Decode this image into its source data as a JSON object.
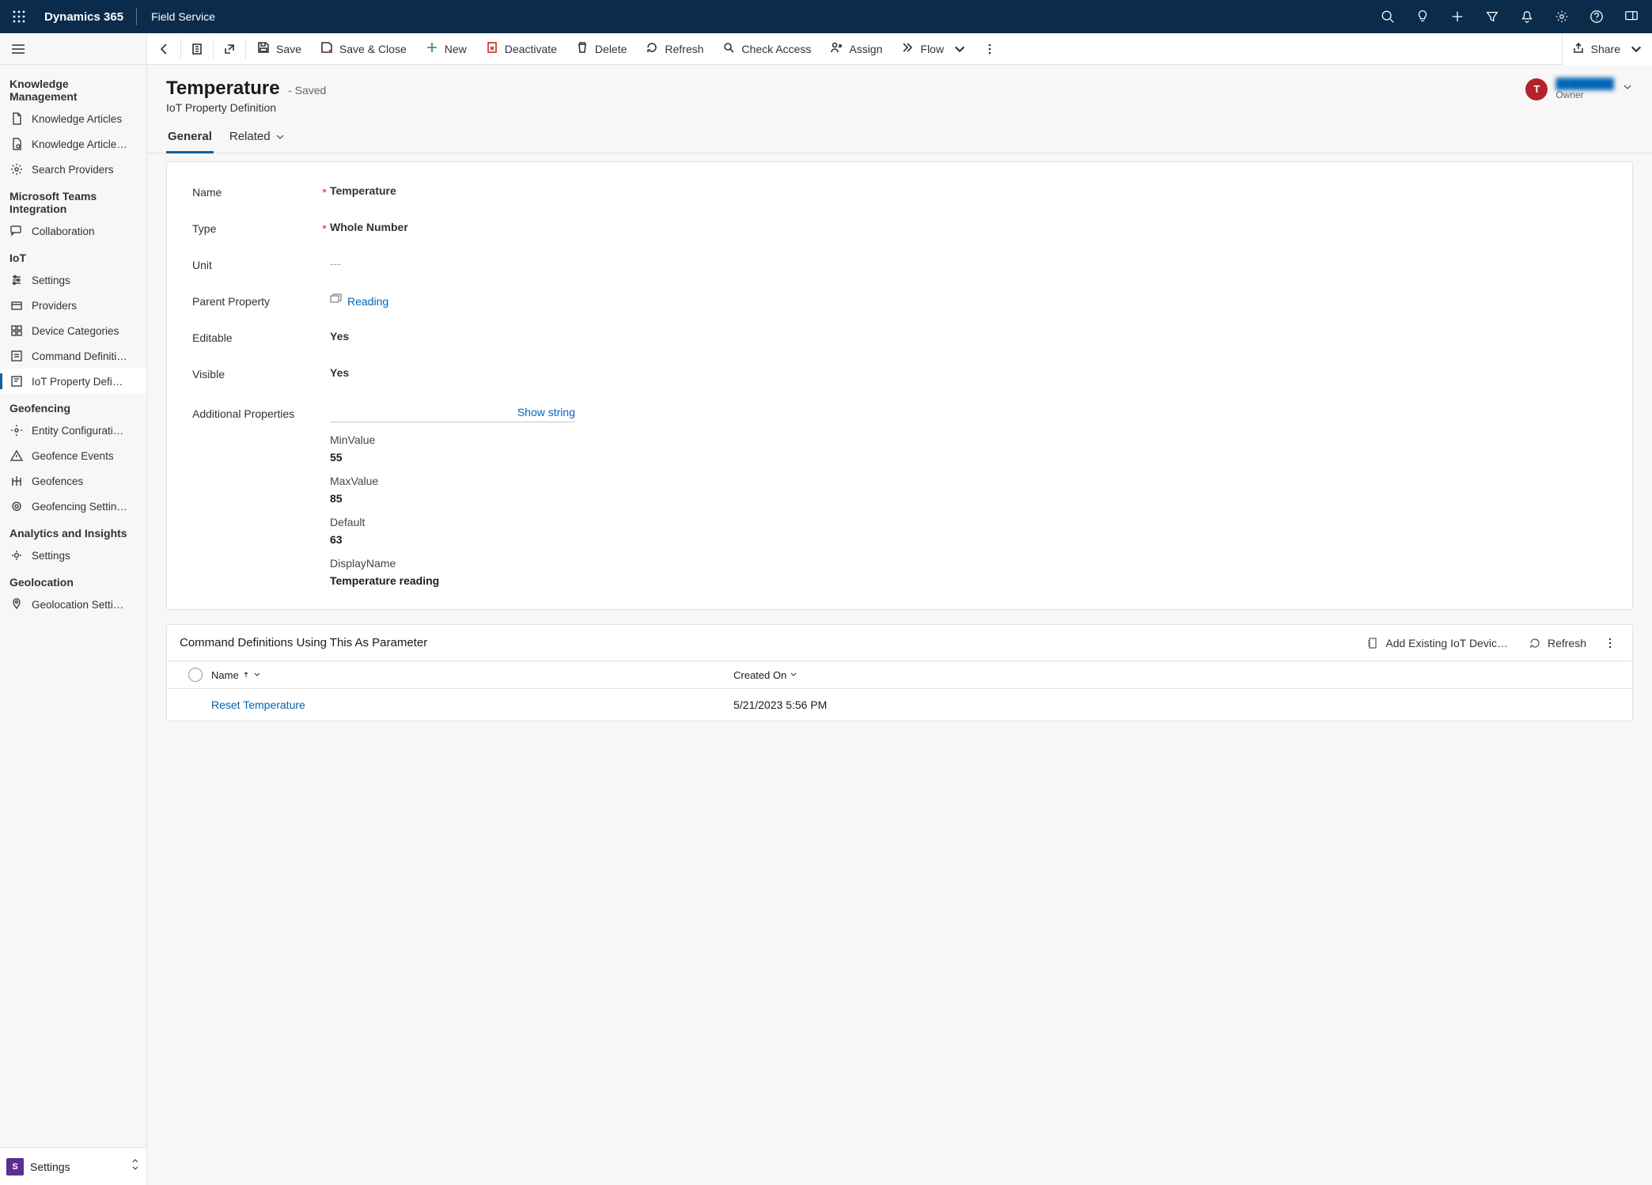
{
  "topnav": {
    "brand": "Dynamics 365",
    "area": "Field Service"
  },
  "sidebar": {
    "groups": [
      {
        "title": "Knowledge Management",
        "items": [
          {
            "label": "Knowledge Articles",
            "icon": "doc"
          },
          {
            "label": "Knowledge Article…",
            "icon": "doc-cog"
          },
          {
            "label": "Search Providers",
            "icon": "gear"
          }
        ]
      },
      {
        "title": "Microsoft Teams Integration",
        "items": [
          {
            "label": "Collaboration",
            "icon": "chat"
          }
        ]
      },
      {
        "title": "IoT",
        "items": [
          {
            "label": "Settings",
            "icon": "sliders"
          },
          {
            "label": "Providers",
            "icon": "box"
          },
          {
            "label": "Device Categories",
            "icon": "grid"
          },
          {
            "label": "Command Definiti…",
            "icon": "list"
          },
          {
            "label": "IoT Property Defi…",
            "icon": "tag",
            "active": true
          }
        ]
      },
      {
        "title": "Geofencing",
        "items": [
          {
            "label": "Entity Configurati…",
            "icon": "gear"
          },
          {
            "label": "Geofence Events",
            "icon": "warn"
          },
          {
            "label": "Geofences",
            "icon": "fence"
          },
          {
            "label": "Geofencing Settin…",
            "icon": "target"
          }
        ]
      },
      {
        "title": "Analytics and Insights",
        "items": [
          {
            "label": "Settings",
            "icon": "gear2"
          }
        ]
      },
      {
        "title": "Geolocation",
        "items": [
          {
            "label": "Geolocation Setti…",
            "icon": "pin"
          }
        ]
      }
    ],
    "area_switch": {
      "chip": "S",
      "label": "Settings"
    }
  },
  "commandbar": {
    "save": "Save",
    "saveclose": "Save & Close",
    "new": "New",
    "deactivate": "Deactivate",
    "delete": "Delete",
    "refresh": "Refresh",
    "checkaccess": "Check Access",
    "assign": "Assign",
    "flow": "Flow",
    "share": "Share"
  },
  "record": {
    "title": "Temperature",
    "status": "- Saved",
    "type": "IoT Property Definition",
    "owner_initial": "T",
    "owner_name": "████████",
    "owner_label": "Owner"
  },
  "tabs": {
    "general": "General",
    "related": "Related"
  },
  "form": {
    "name_label": "Name",
    "name_value": "Temperature",
    "type_label": "Type",
    "type_value": "Whole Number",
    "unit_label": "Unit",
    "unit_value": "---",
    "parent_label": "Parent Property",
    "parent_value": "Reading",
    "editable_label": "Editable",
    "editable_value": "Yes",
    "visible_label": "Visible",
    "visible_value": "Yes",
    "addprops_label": "Additional Properties",
    "showstring": "Show string",
    "fields": {
      "min_k": "MinValue",
      "min_v": "55",
      "max_k": "MaxValue",
      "max_v": "85",
      "def_k": "Default",
      "def_v": "63",
      "disp_k": "DisplayName",
      "disp_v": "Temperature reading"
    }
  },
  "subgrid": {
    "title": "Command Definitions Using This As Parameter",
    "add": "Add Existing IoT Devic…",
    "refresh": "Refresh",
    "col_name": "Name",
    "col_created": "Created On",
    "rows": [
      {
        "name": "Reset Temperature",
        "created": "5/21/2023 5:56 PM"
      }
    ]
  }
}
